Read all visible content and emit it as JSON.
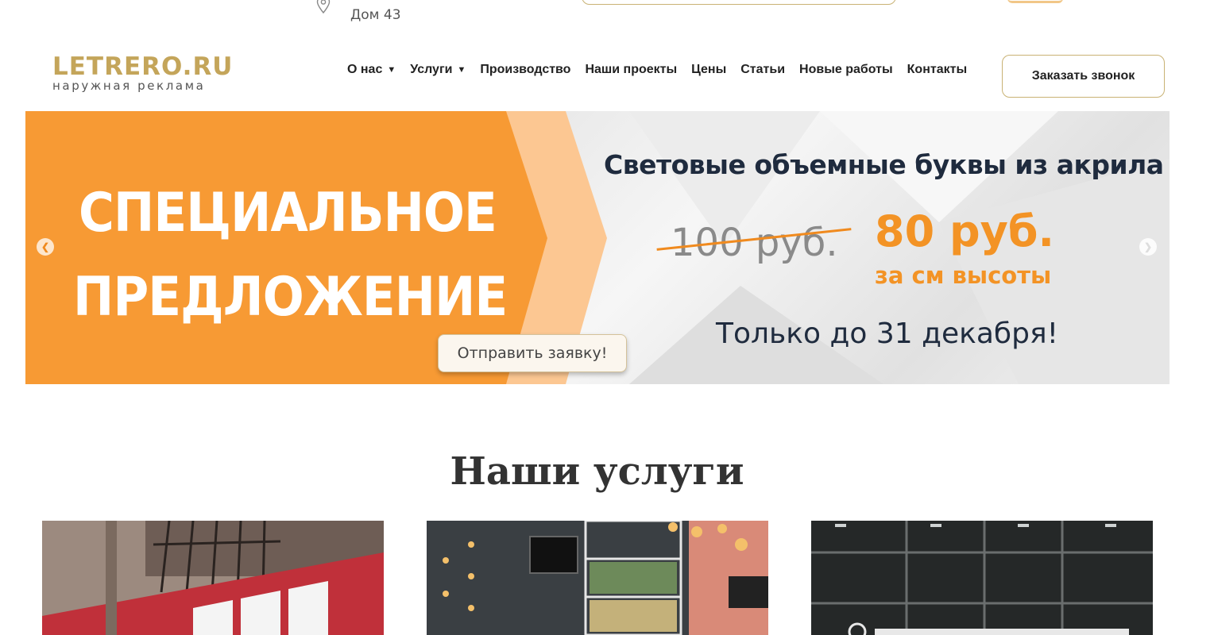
{
  "topbar": {
    "address_line2": "Дом 43"
  },
  "brand": {
    "name": "LETRERO.RU",
    "tagline": "наружная реклама",
    "accent_color": "#c4a55a"
  },
  "nav": {
    "items": [
      {
        "label": "О нас",
        "has_dropdown": true
      },
      {
        "label": "Услуги",
        "has_dropdown": true
      },
      {
        "label": "Производство",
        "has_dropdown": false
      },
      {
        "label": "Наши проекты",
        "has_dropdown": false
      },
      {
        "label": "Цены",
        "has_dropdown": false
      },
      {
        "label": "Статьи",
        "has_dropdown": false
      },
      {
        "label": "Новые работы",
        "has_dropdown": false
      },
      {
        "label": "Контакты",
        "has_dropdown": false
      }
    ],
    "dropdown_glyph": "▼"
  },
  "header": {
    "callback_label": "Заказать звонок"
  },
  "banner": {
    "promo_line1": "СПЕЦИАЛЬНОЕ",
    "promo_line2": "ПРЕДЛОЖЕНИЕ",
    "title": "Световые объемные буквы из акрила",
    "old_price": "100 руб.",
    "new_price": "80 руб.",
    "price_unit": "за см высоты",
    "deadline": "Только до 31 декабря!",
    "apply_label": "Отправить заявку!",
    "prev_glyph": "❮",
    "next_glyph": "❯",
    "promo_color": "#f79a34",
    "price_color": "#f39325"
  },
  "services": {
    "title": "Наши услуги"
  }
}
